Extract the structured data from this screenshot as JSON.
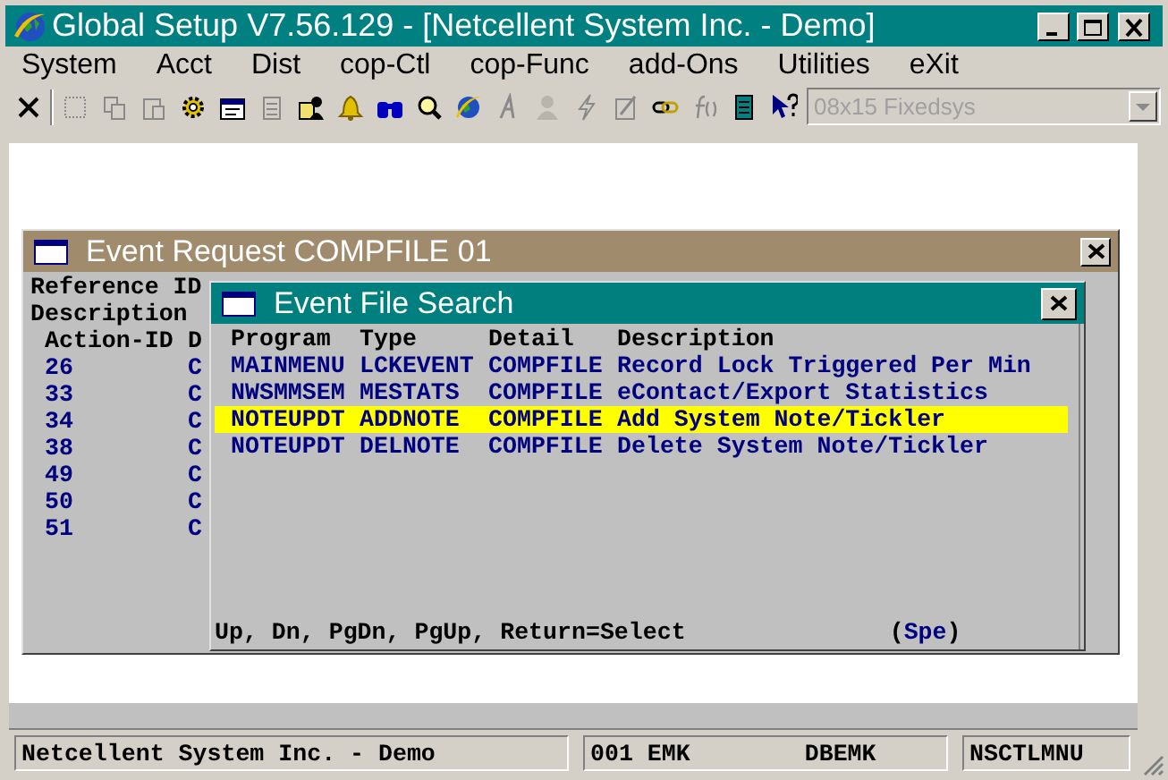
{
  "window": {
    "title": "Global Setup V7.56.129 - [Netcellent System Inc. - Demo]"
  },
  "menu": [
    {
      "label": "System"
    },
    {
      "label": "Acct"
    },
    {
      "label": "Dist"
    },
    {
      "label": "cop-Ctl"
    },
    {
      "label": "cop-Func"
    },
    {
      "label": "add-Ons"
    },
    {
      "label": "Utilities"
    },
    {
      "label": "eXit"
    }
  ],
  "toolbar": {
    "tools": [
      {
        "disabled": false
      },
      {
        "disabled": true
      },
      {
        "disabled": true
      },
      {
        "disabled": true
      },
      {
        "disabled": false
      },
      {
        "disabled": false
      },
      {
        "disabled": true
      },
      {
        "disabled": false
      },
      {
        "disabled": false
      },
      {
        "disabled": false
      },
      {
        "disabled": false
      },
      {
        "disabled": false
      },
      {
        "disabled": true
      },
      {
        "disabled": true
      },
      {
        "disabled": true
      },
      {
        "disabled": true
      },
      {
        "disabled": false
      },
      {
        "disabled": true
      },
      {
        "disabled": false
      },
      {
        "disabled": false
      }
    ],
    "font_box": {
      "value": "08x15 Fixedsys",
      "disabled": true
    }
  },
  "event_request": {
    "title": "Event Request COMPFILE 01",
    "fields": [
      "Reference ID",
      "Description"
    ],
    "columns": [
      "Action-ID",
      "D"
    ],
    "rows": [
      [
        "26",
        "C"
      ],
      [
        "33",
        "C"
      ],
      [
        "34",
        "C"
      ],
      [
        "38",
        "C"
      ],
      [
        "49",
        "C"
      ],
      [
        "50",
        "C"
      ],
      [
        "51",
        "C"
      ]
    ]
  },
  "event_file_search": {
    "title": "Event File Search",
    "columns": [
      "Program",
      "Type",
      "Detail",
      "Description"
    ],
    "rows": [
      {
        "cells": [
          "MAINMENU",
          "LCKEVENT",
          "COMPFILE",
          "Record Lock Triggered Per Min"
        ],
        "selected": false
      },
      {
        "cells": [
          "NWSMMSEM",
          "MESTATS",
          "COMPFILE",
          "eContact/Export Statistics"
        ],
        "selected": false
      },
      {
        "cells": [
          "NOTEUPDT",
          "ADDNOTE",
          "COMPFILE",
          "Add System Note/Tickler"
        ],
        "selected": true
      },
      {
        "cells": [
          "NOTEUPDT",
          "DELNOTE",
          "COMPFILE",
          "Delete System Note/Tickler"
        ],
        "selected": false
      }
    ],
    "footer": "Up, Dn, PgDn, PgUp, Return=Select",
    "hint": [
      "(",
      "Spe",
      ")"
    ]
  },
  "status_bar": [
    [
      "Netcellent System Inc. - Demo"
    ],
    [
      "001 EMK",
      "DBEMK"
    ],
    [
      "NSCTLMNU"
    ]
  ]
}
